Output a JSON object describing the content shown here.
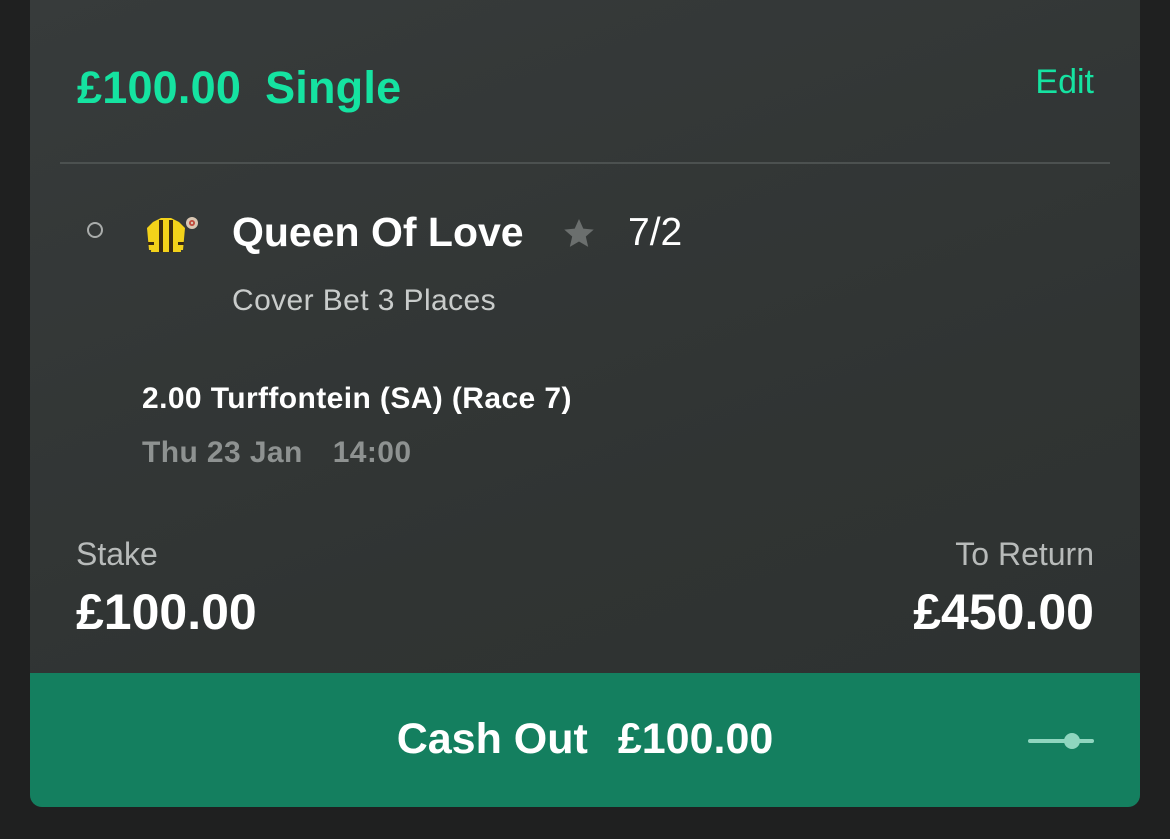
{
  "bet": {
    "stake_display": "£100.00",
    "type": "Single",
    "edit_label": "Edit"
  },
  "selection": {
    "name": "Queen Of Love",
    "odds": "7/2",
    "market": "Cover Bet 3 Places"
  },
  "event": {
    "name": "2.00 Turffontein (SA) (Race 7)",
    "date": "Thu 23 Jan",
    "time": "14:00"
  },
  "summary": {
    "stake_label": "Stake",
    "stake_value": "£100.00",
    "return_label": "To Return",
    "return_value": "£450.00"
  },
  "cashout": {
    "label": "Cash Out",
    "amount": "£100.00"
  },
  "icons": {
    "status": "circle-outline-icon",
    "silks": "jockey-silks-icon",
    "favourite": "star-icon",
    "slider": "cashout-slider-icon"
  },
  "colors": {
    "accent": "#15e3a1",
    "cashout_bg": "#147f5f",
    "card_bg": "#333736",
    "page_bg": "#1f2020"
  }
}
